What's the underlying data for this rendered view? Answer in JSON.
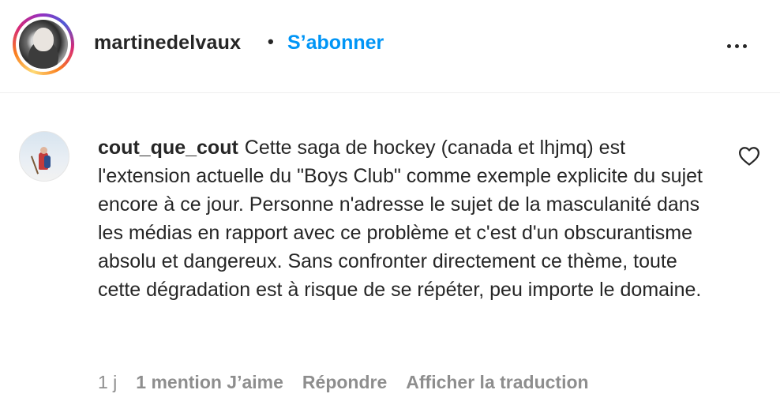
{
  "post": {
    "username": "martinedelvaux",
    "separator": "•",
    "follow_label": "S’abonner",
    "more_icon": "more-horizontal-icon"
  },
  "comment": {
    "username": "cout_que_cout",
    "text": "Cette saga de hockey (canada et lhjmq) est l'extension actuelle du \"Boys Club\" comme exemple explicite du sujet encore à ce jour. Personne n'adresse le sujet de la masculanité dans les médias en rapport avec ce problème et c'est d'un obscurantisme absolu et dangereux. Sans confronter directement ce thème, toute cette dégradation est à risque de se répéter, peu importe le domaine.",
    "time": "1 j",
    "likes_label": "1 mention J’aime",
    "reply_label": "Répondre",
    "translate_label": "Afficher la traduction",
    "like_icon": "heart-outline-icon"
  },
  "colors": {
    "link": "#0095f6",
    "text": "#262626",
    "muted": "#8e8e8e",
    "divider": "#efefef"
  }
}
